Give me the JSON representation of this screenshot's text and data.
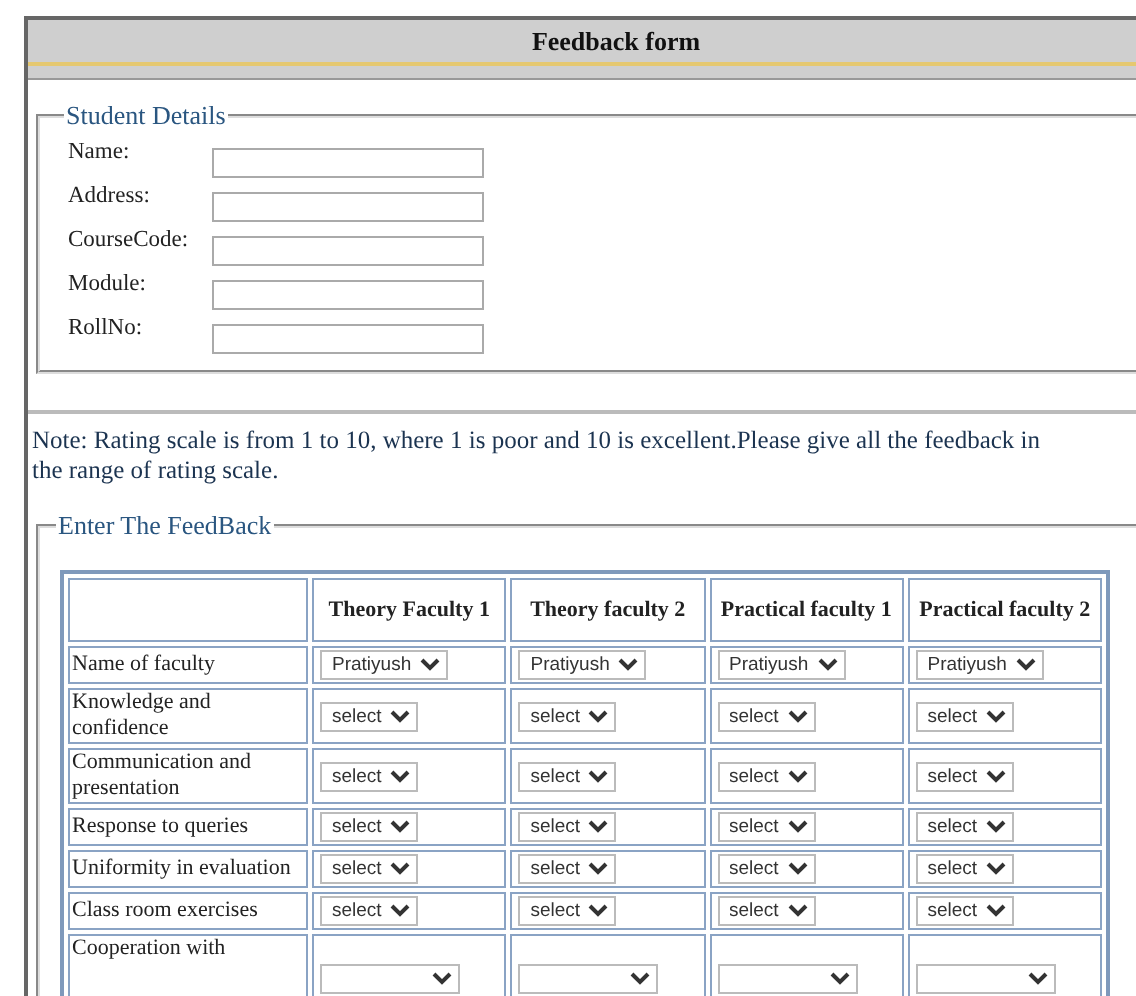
{
  "window": {
    "title": "Feedback form"
  },
  "student_details": {
    "legend": "Student Details",
    "fields": [
      {
        "label": "Name:"
      },
      {
        "label": "Address:"
      },
      {
        "label": "CourseCode:"
      },
      {
        "label": "Module:"
      },
      {
        "label": "RollNo:"
      }
    ]
  },
  "note": "Note: Rating scale is from 1 to 10, where 1 is poor and 10 is excellent.Please give all the feedback in the range of rating scale.",
  "feedback": {
    "legend": "Enter The FeedBack",
    "columns": [
      "Theory Faculty 1",
      "Theory faculty 2",
      "Practical faculty 1",
      "Practical faculty 2"
    ],
    "rows": [
      {
        "label": "Name of faculty",
        "cells": [
          "Pratiyush",
          "Pratiyush",
          "Pratiyush",
          "Pratiyush"
        ]
      },
      {
        "label": "Knowledge and confidence",
        "cells": [
          "select",
          "select",
          "select",
          "select"
        ]
      },
      {
        "label": "Communication and presentation",
        "cells": [
          "select",
          "select",
          "select",
          "select"
        ]
      },
      {
        "label": "Response to queries",
        "cells": [
          "select",
          "select",
          "select",
          "select"
        ]
      },
      {
        "label": "Uniformity in evaluation",
        "cells": [
          "select",
          "select",
          "select",
          "select"
        ]
      },
      {
        "label": "Class room exercises",
        "cells": [
          "select",
          "select",
          "select",
          "select"
        ]
      },
      {
        "label": "Cooperation with"
      }
    ]
  }
}
